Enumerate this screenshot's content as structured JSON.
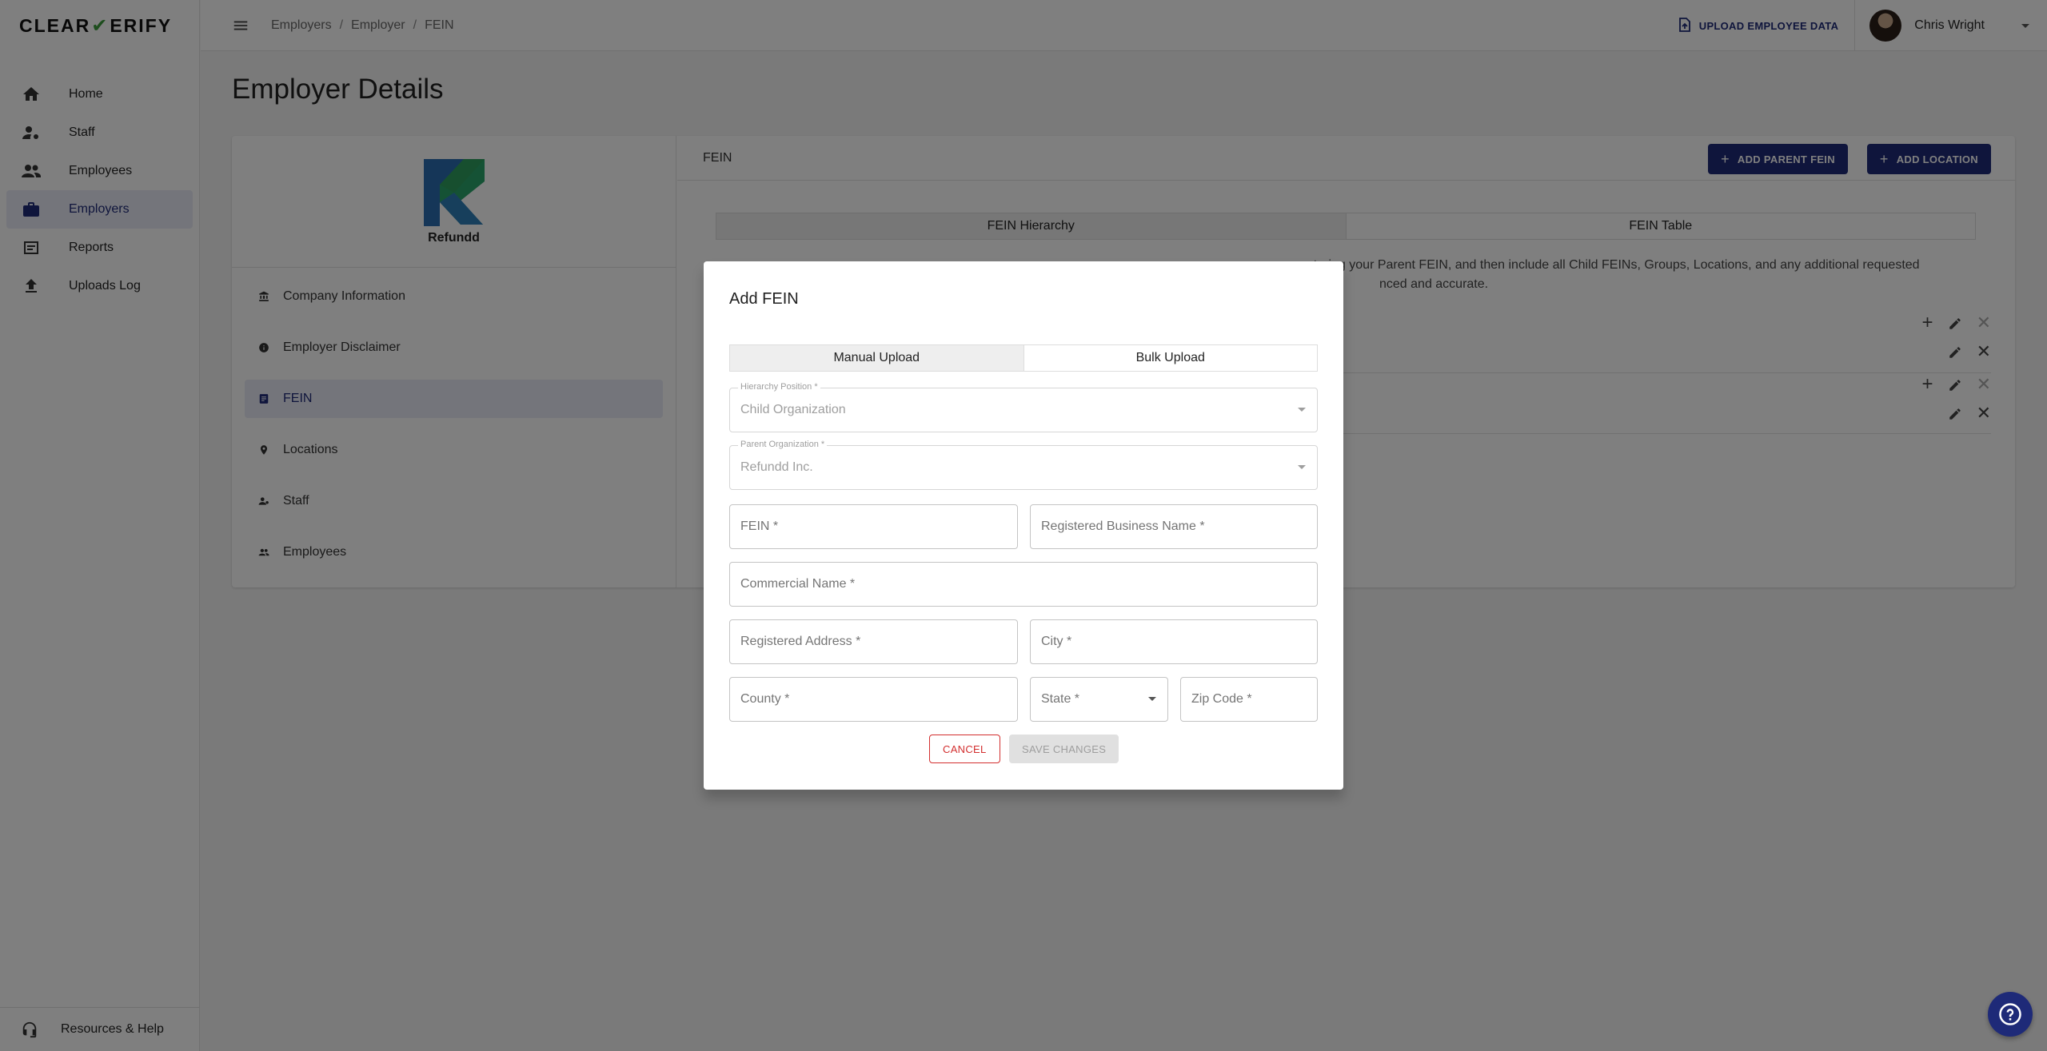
{
  "brand": {
    "logo_text_1": "CLEAR",
    "logo_check": "✔",
    "logo_text_2": "ERIFY"
  },
  "sidebar": {
    "items": [
      {
        "label": "Home",
        "icon": "home-icon"
      },
      {
        "label": "Staff",
        "icon": "staff-icon"
      },
      {
        "label": "Employees",
        "icon": "employees-icon"
      },
      {
        "label": "Employers",
        "icon": "briefcase-icon",
        "active": true
      },
      {
        "label": "Reports",
        "icon": "reports-icon"
      },
      {
        "label": "Uploads Log",
        "icon": "upload-icon"
      }
    ],
    "footer_label": "Resources & Help"
  },
  "topbar": {
    "breadcrumb": [
      "Employers",
      "Employer",
      "FEIN"
    ],
    "upload_label": "UPLOAD EMPLOYEE DATA",
    "user_name": "Chris Wright"
  },
  "page": {
    "title": "Employer Details",
    "company_name": "Refundd",
    "menu": [
      {
        "label": "Company Information",
        "icon": "bank-icon"
      },
      {
        "label": "Employer Disclaimer",
        "icon": "info-icon"
      },
      {
        "label": "FEIN",
        "icon": "badge-icon",
        "active": true
      },
      {
        "label": "Locations",
        "icon": "pin-icon"
      },
      {
        "label": "Staff",
        "icon": "staff-icon"
      },
      {
        "label": "Employees",
        "icon": "people-icon"
      }
    ],
    "section_title": "FEIN",
    "add_parent_label": "ADD PARENT FEIN",
    "add_location_label": "ADD LOCATION",
    "tabs": [
      "FEIN Hierarchy",
      "FEIN Table"
    ],
    "desc_line_1": "entering your Parent FEIN, and then include all Child FEINs, Groups, Locations, and any additional requested",
    "desc_line_2": "nced and accurate."
  },
  "modal": {
    "title": "Add FEIN",
    "tabs": [
      "Manual Upload",
      "Bulk Upload"
    ],
    "hierarchy_label": "Hierarchy Position *",
    "hierarchy_value": "Child Organization",
    "parent_label": "Parent Organization *",
    "parent_value": "Refundd Inc.",
    "fein_ph": "FEIN *",
    "business_name_ph": "Registered Business Name *",
    "commercial_name_ph": "Commercial Name *",
    "address_ph": "Registered Address *",
    "city_ph": "City *",
    "county_ph": "County *",
    "state_ph": "State *",
    "zip_ph": "Zip Code *",
    "cancel_label": "CANCEL",
    "save_label": "SAVE CHANGES"
  }
}
